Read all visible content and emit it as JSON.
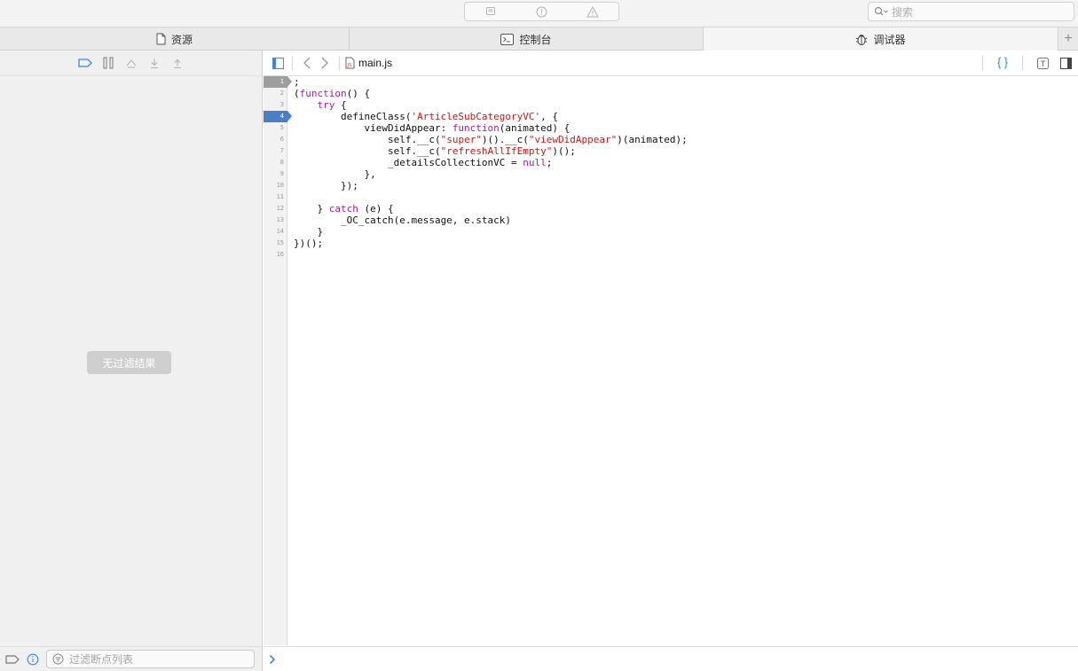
{
  "search": {
    "placeholder": "搜索"
  },
  "tabs": [
    {
      "label": "资源",
      "icon": "document-icon"
    },
    {
      "label": "控制台",
      "icon": "console-icon"
    },
    {
      "label": "调试器",
      "icon": "bug-icon"
    }
  ],
  "left": {
    "empty_label": "无过滤结果",
    "filter_placeholder": "过滤断点列表"
  },
  "editor": {
    "file_name": "main.js",
    "lines": [
      {
        "n": "1",
        "text": ";"
      },
      {
        "n": "2",
        "text": "(function() {"
      },
      {
        "n": "3",
        "text": "    try {"
      },
      {
        "n": "4",
        "text": "        defineClass('ArticleSubCategoryVC', {"
      },
      {
        "n": "5",
        "text": "            viewDidAppear: function(animated) {"
      },
      {
        "n": "6",
        "text": "                self.__c(\"super\")().__c(\"viewDidAppear\")(animated);"
      },
      {
        "n": "7",
        "text": "                self.__c(\"refreshAllIfEmpty\")();"
      },
      {
        "n": "8",
        "text": "                _detailsCollectionVC = null;"
      },
      {
        "n": "9",
        "text": "            },"
      },
      {
        "n": "10",
        "text": "        });"
      },
      {
        "n": "11",
        "text": ""
      },
      {
        "n": "12",
        "text": "    } catch (e) {"
      },
      {
        "n": "13",
        "text": "        _OC_catch(e.message, e.stack)"
      },
      {
        "n": "14",
        "text": "    }"
      },
      {
        "n": "15",
        "text": "})();"
      },
      {
        "n": "16",
        "text": ""
      }
    ],
    "current_line": "1",
    "breakpoint_line": "4"
  },
  "colors": {
    "accent": "#4a7fc7",
    "keyword": "#a41ea4",
    "string": "#c41a16"
  }
}
